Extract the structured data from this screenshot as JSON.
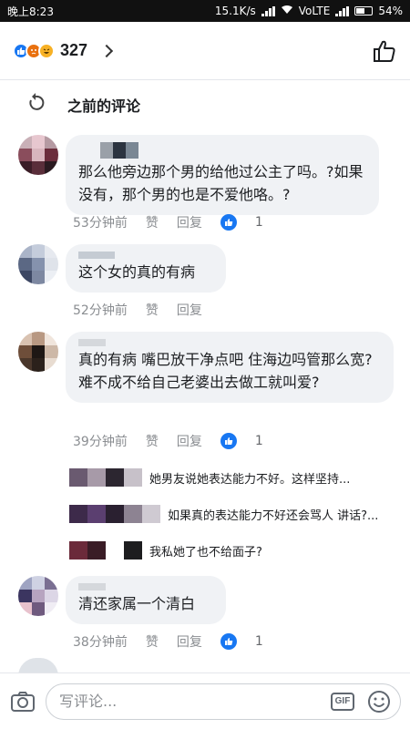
{
  "status_bar": {
    "time": "晚上8:23",
    "speed": "15.1K/s",
    "network": "VoLTE",
    "battery": "54%"
  },
  "header": {
    "reaction_count": "327"
  },
  "previous_comments_label": "之前的评论",
  "comments": [
    {
      "text": "那么他旁边那个男的给他过公主了吗。?如果没有，那个男的也是不爱他咯。?",
      "time": "53分钟前",
      "like_label": "赞",
      "reply_label": "回复",
      "likes": "1"
    },
    {
      "text": "这个女的真的有病",
      "time": "52分钟前",
      "like_label": "赞",
      "reply_label": "回复"
    },
    {
      "text": "真的有病 嘴巴放干净点吧 住海边吗管那么宽? 难不成不给自己老婆出去做工就叫爱?",
      "time": "39分钟前",
      "like_label": "赞",
      "reply_label": "回复",
      "likes": "1"
    },
    {
      "text": "清还家属一个清白",
      "time": "38分钟前",
      "like_label": "赞",
      "reply_label": "回复",
      "likes": "1"
    }
  ],
  "replies": [
    {
      "text": "她男友说她表达能力不好。这样坚持..."
    },
    {
      "text": "如果真的表达能力不好还会骂人 讲话?..."
    },
    {
      "text": "我私她了也不给面子?"
    }
  ],
  "input": {
    "placeholder": "写评论..."
  },
  "colors": {
    "accent": "#1877f2",
    "bubble": "#f0f2f5",
    "meta": "#8a8d91"
  }
}
